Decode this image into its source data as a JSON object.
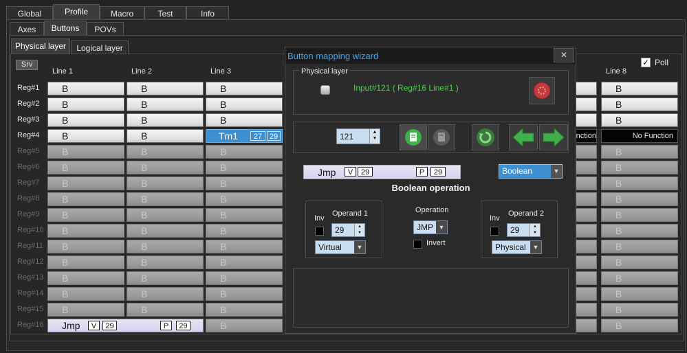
{
  "main_tabs": [
    "Global",
    "Profile",
    "Macro",
    "Test",
    "Info"
  ],
  "sub_tabs": [
    "Axes",
    "Buttons",
    "POVs"
  ],
  "layer_tabs": [
    "Physical layer",
    "Logical layer"
  ],
  "srv_label": "Srv",
  "poll_label": "Poll",
  "columns": [
    "Line 1",
    "Line 2",
    "Line 3",
    "Line 8"
  ],
  "rows": [
    "Reg#1",
    "Reg#2",
    "Reg#3",
    "Reg#4",
    "Reg#5",
    "Reg#6",
    "Reg#7",
    "Reg#8",
    "Reg#9",
    "Reg#10",
    "Reg#11",
    "Reg#12",
    "Reg#13",
    "Reg#14",
    "Reg#15",
    "Reg#16"
  ],
  "cell_text": "B",
  "reg4": {
    "line3_label": "Tm1",
    "line3_v1": "27",
    "line3_v2": "29",
    "partial_label": "nction",
    "line8_label": "No Function"
  },
  "reg16": {
    "label": "Jmp",
    "v_tag": "V",
    "v_num": "29",
    "p_tag": "P",
    "p_num": "29"
  },
  "dialog": {
    "title": "Button mapping wizard",
    "close": "✕",
    "physical_layer": "Physical layer",
    "input_text": "Input#121  ( Reg#16  Line#1 )",
    "spin_value": "121",
    "preview_label": "Jmp",
    "preview_v": "V",
    "preview_v_num": "29",
    "preview_p": "P",
    "preview_p_num": "29",
    "mode_value": "Boolean",
    "operation_title": "Boolean operation",
    "inv_label": "Inv",
    "operand1_label": "Operand 1",
    "operand1_value": "29",
    "operand1_source": "Virtual",
    "operation_label": "Operation",
    "operation_value": "JMP",
    "invert_label": "Invert",
    "inv2_label": "Inv",
    "operand2_label": "Operand 2",
    "operand2_value": "29",
    "operand2_source": "Physical"
  },
  "colors": {
    "accent_blue": "#3d8fd0",
    "input_green": "#4cd34c",
    "title_blue": "#3fa8e8"
  }
}
